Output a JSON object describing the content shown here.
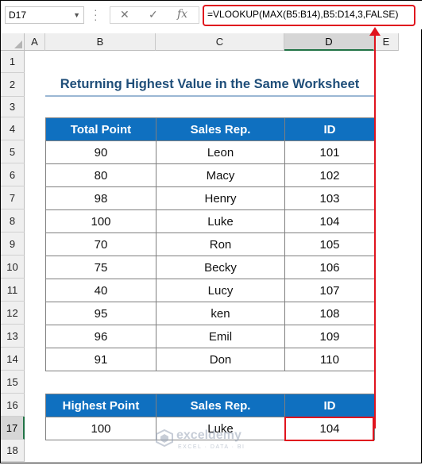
{
  "formula_bar": {
    "name_box": "D17",
    "cancel_icon": "✕",
    "enter_icon": "✓",
    "fx_icon": "fx",
    "formula": "=VLOOKUP(MAX(B5:B14),B5:D14,3,FALSE)"
  },
  "columns": [
    "A",
    "B",
    "C",
    "D",
    "E"
  ],
  "rows": [
    "1",
    "2",
    "3",
    "4",
    "5",
    "6",
    "7",
    "8",
    "9",
    "10",
    "11",
    "12",
    "13",
    "14",
    "15",
    "16",
    "17",
    "18"
  ],
  "selected_cell": "D17",
  "title": "Returning Highest Value in the Same Worksheet",
  "table1": {
    "headers": [
      "Total Point",
      "Sales Rep.",
      "ID"
    ],
    "rows": [
      [
        "90",
        "Leon",
        "101"
      ],
      [
        "80",
        "Macy",
        "102"
      ],
      [
        "98",
        "Henry",
        "103"
      ],
      [
        "100",
        "Luke",
        "104"
      ],
      [
        "70",
        "Ron",
        "105"
      ],
      [
        "75",
        "Becky",
        "106"
      ],
      [
        "40",
        "Lucy",
        "107"
      ],
      [
        "95",
        "ken",
        "108"
      ],
      [
        "96",
        "Emil",
        "109"
      ],
      [
        "91",
        "Don",
        "110"
      ]
    ]
  },
  "table2": {
    "headers": [
      "Highest Point",
      "Sales Rep.",
      "ID"
    ],
    "row": [
      "100",
      "Luke",
      "104"
    ]
  },
  "watermark": {
    "name": "exceldemy",
    "tagline": "EXCEL · DATA · BI"
  },
  "colors": {
    "header_fill": "#0f70c0",
    "highlight": "#e0141e",
    "title": "#1f4e79"
  }
}
